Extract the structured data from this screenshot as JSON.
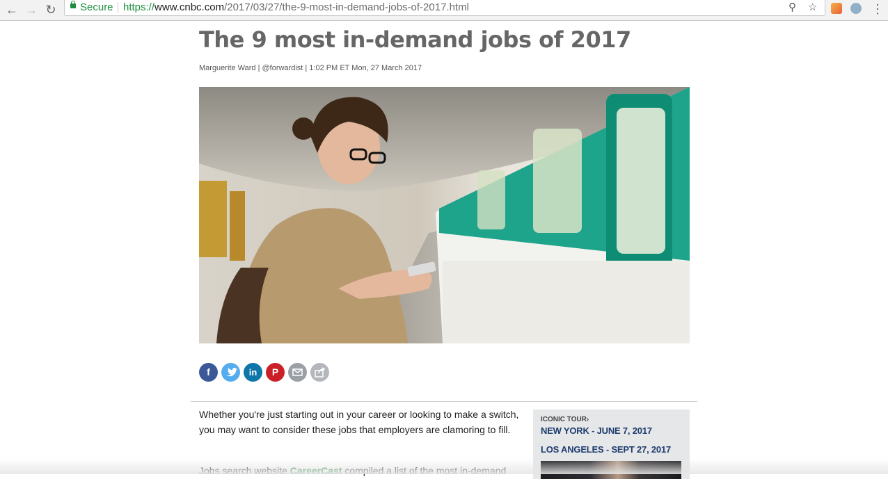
{
  "browser": {
    "secure_label": "Secure",
    "url_protocol": "https://",
    "url_host": "www.cnbc.com",
    "url_path": "/2017/03/27/the-9-most-in-demand-jobs-of-2017.html"
  },
  "article": {
    "headline": "The 9 most in-demand jobs of 2017",
    "byline": "Marguerite Ward | @forwardist | 1:02 PM ET Mon, 27 March 2017",
    "share_buttons": [
      "facebook",
      "twitter",
      "linkedin",
      "pinterest",
      "email",
      "share"
    ],
    "paragraph1": "Whether you're just starting out in your career or looking to make a switch, you may want to consider these jobs that employers are clamoring to fill.",
    "paragraph2_start": "Jobs search website ",
    "paragraph2_link": "CareerCast",
    "paragraph2_end": " compiled a list of the most in-demand"
  },
  "sidebar": {
    "kicker": "ICONIC TOUR›",
    "event1": "NEW YORK - JUNE 7, 2017",
    "event2": "LOS ANGELES - SEPT 27, 2017"
  },
  "colors": {
    "secure_green": "#1e8e3e",
    "link_green": "#2a8a3c",
    "sidebar_navy": "#1d3c6e",
    "facebook": "#3b5998",
    "twitter": "#55acee",
    "linkedin": "#0e76a8",
    "pinterest": "#cb2027"
  }
}
